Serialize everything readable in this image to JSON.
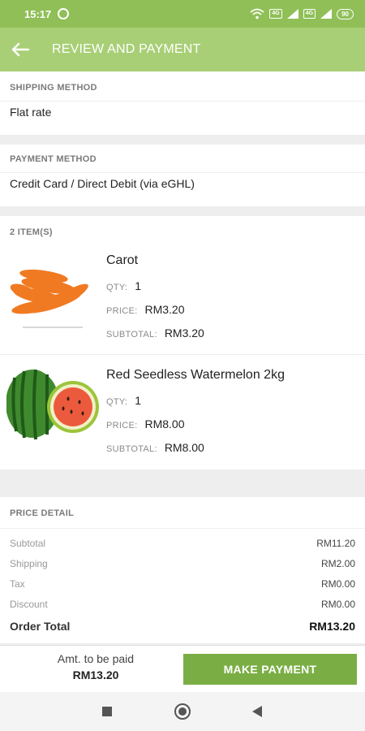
{
  "status_bar": {
    "time": "15:17",
    "icons": [
      "alarm-icon",
      "wifi-icon",
      "signal-icon",
      "battery-icon"
    ],
    "chip_1": "4G",
    "chip_2": "4G",
    "battery": "90"
  },
  "app_bar": {
    "title": "REVIEW AND PAYMENT",
    "back_icon": "arrow-left-icon"
  },
  "shipping": {
    "title": "SHIPPING METHOD",
    "value": "Flat rate"
  },
  "payment": {
    "title": "PAYMENT METHOD",
    "value": "Credit Card / Direct Debit (via eGHL)"
  },
  "items_section": {
    "title": "2 ITEM(S)",
    "qty_label": "QTY:",
    "price_label": "PRICE:",
    "subtotal_label": "SUBTOTAL:",
    "items": [
      {
        "name": "Carot",
        "qty": "1",
        "price": "RM3.20",
        "subtotal": "RM3.20"
      },
      {
        "name": "Red Seedless Watermelon 2kg",
        "qty": "1",
        "price": "RM8.00",
        "subtotal": "RM8.00"
      }
    ]
  },
  "price_detail": {
    "title": "PRICE DETAIL",
    "rows": [
      {
        "label": "Subtotal",
        "value": "RM11.20"
      },
      {
        "label": "Shipping",
        "value": "RM2.00"
      },
      {
        "label": "Tax",
        "value": "RM0.00"
      },
      {
        "label": "Discount",
        "value": "RM0.00"
      }
    ],
    "total_label": "Order Total",
    "total_value": "RM13.20"
  },
  "footer": {
    "amount_label": "Amt. to be paid",
    "amount_value": "RM13.20",
    "button_label": "MAKE PAYMENT"
  },
  "colors": {
    "status_bar": "#8fbf56",
    "app_bar": "#a8cf76",
    "button": "#7aae44"
  }
}
